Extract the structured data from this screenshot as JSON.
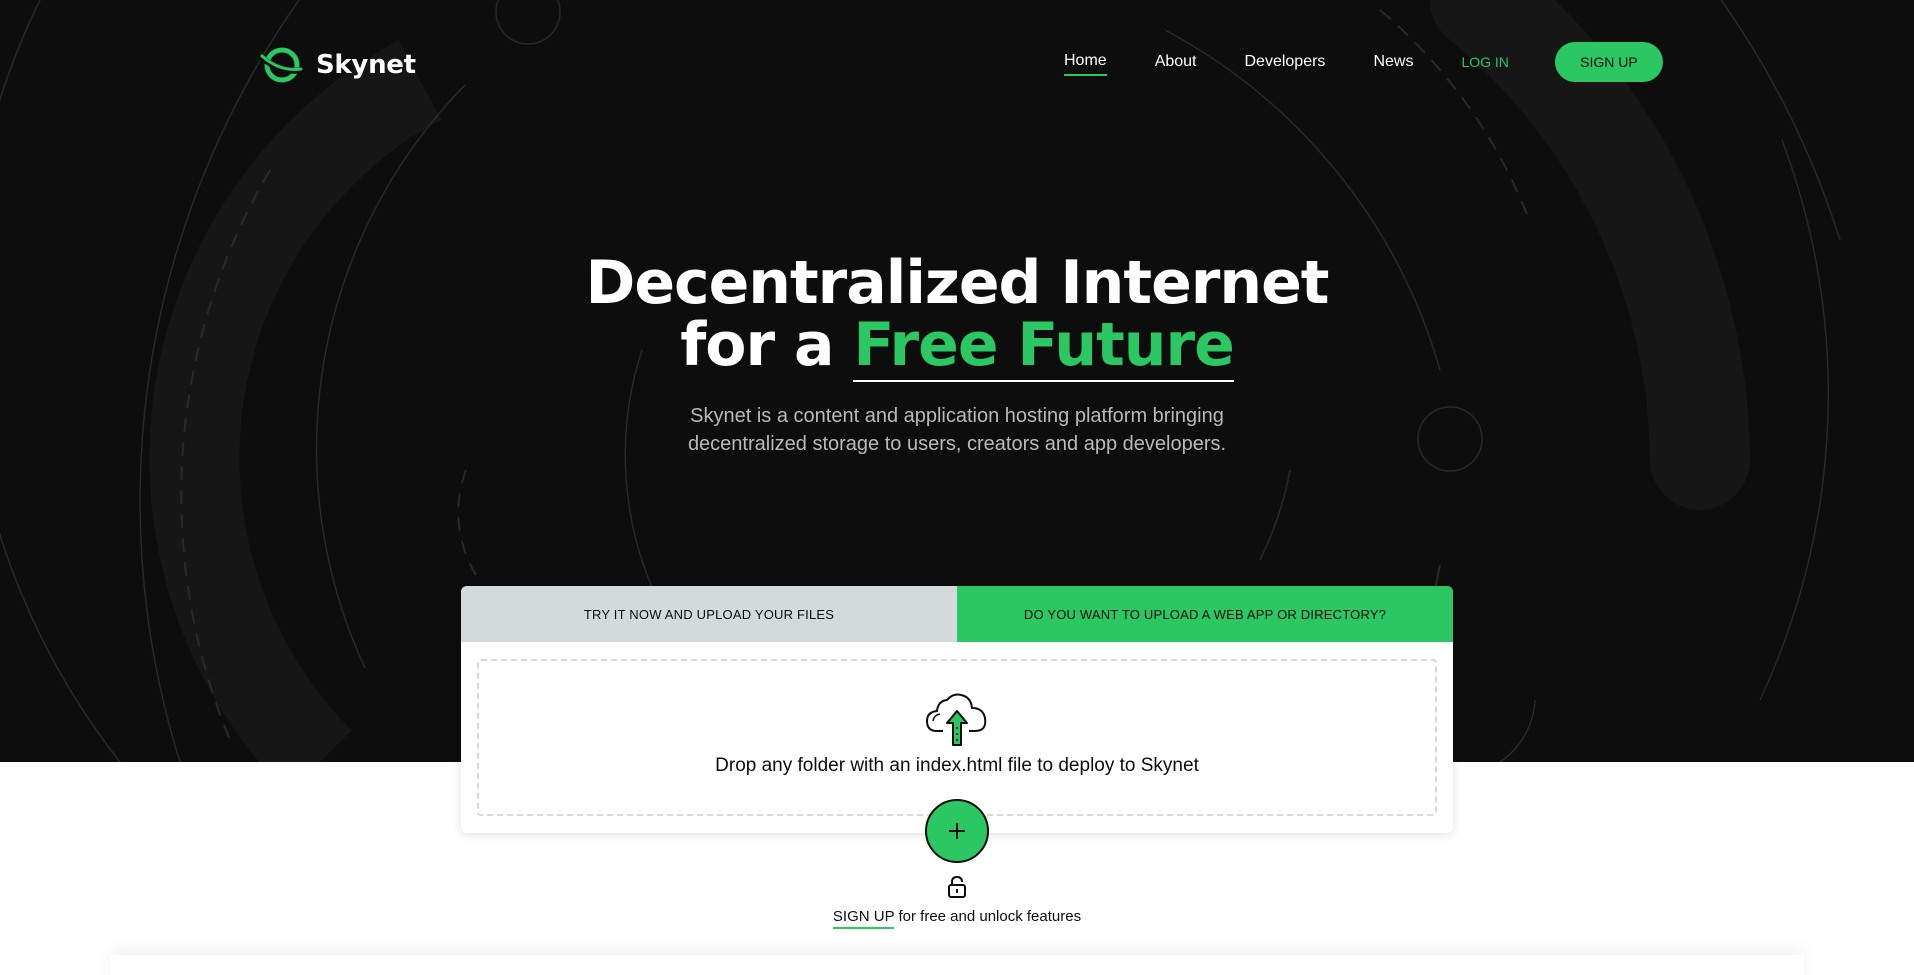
{
  "colors": {
    "accent": "#2bc763",
    "dark": "#0d0d0d",
    "tab_inactive": "#d4dada"
  },
  "brand": {
    "name": "Skynet",
    "logo_icon": "skynet-logo-icon"
  },
  "nav": {
    "home": "Home",
    "about": "About",
    "developers": "Developers",
    "news": "News",
    "login": "LOG IN",
    "signup": "SIGN UP"
  },
  "hero": {
    "headline_line1": "Decentralized Internet",
    "headline_line2_prefix": "for a ",
    "headline_accent": "Free Future",
    "subtitle": "Skynet is a content and application hosting platform bringing decentralized storage to users, creators and app developers."
  },
  "upload": {
    "tab_files": "TRY IT NOW AND UPLOAD YOUR FILES",
    "tab_webapp": "DO YOU WANT TO UPLOAD A WEB APP OR DIRECTORY?",
    "drop_text": "Drop any folder with an index.html file to deploy to Skynet",
    "drop_icon": "cloud-upload-icon",
    "add_icon": "plus-icon"
  },
  "signup_prompt": {
    "link": "SIGN UP",
    "rest": " for free and unlock features",
    "icon": "unlock-icon"
  }
}
